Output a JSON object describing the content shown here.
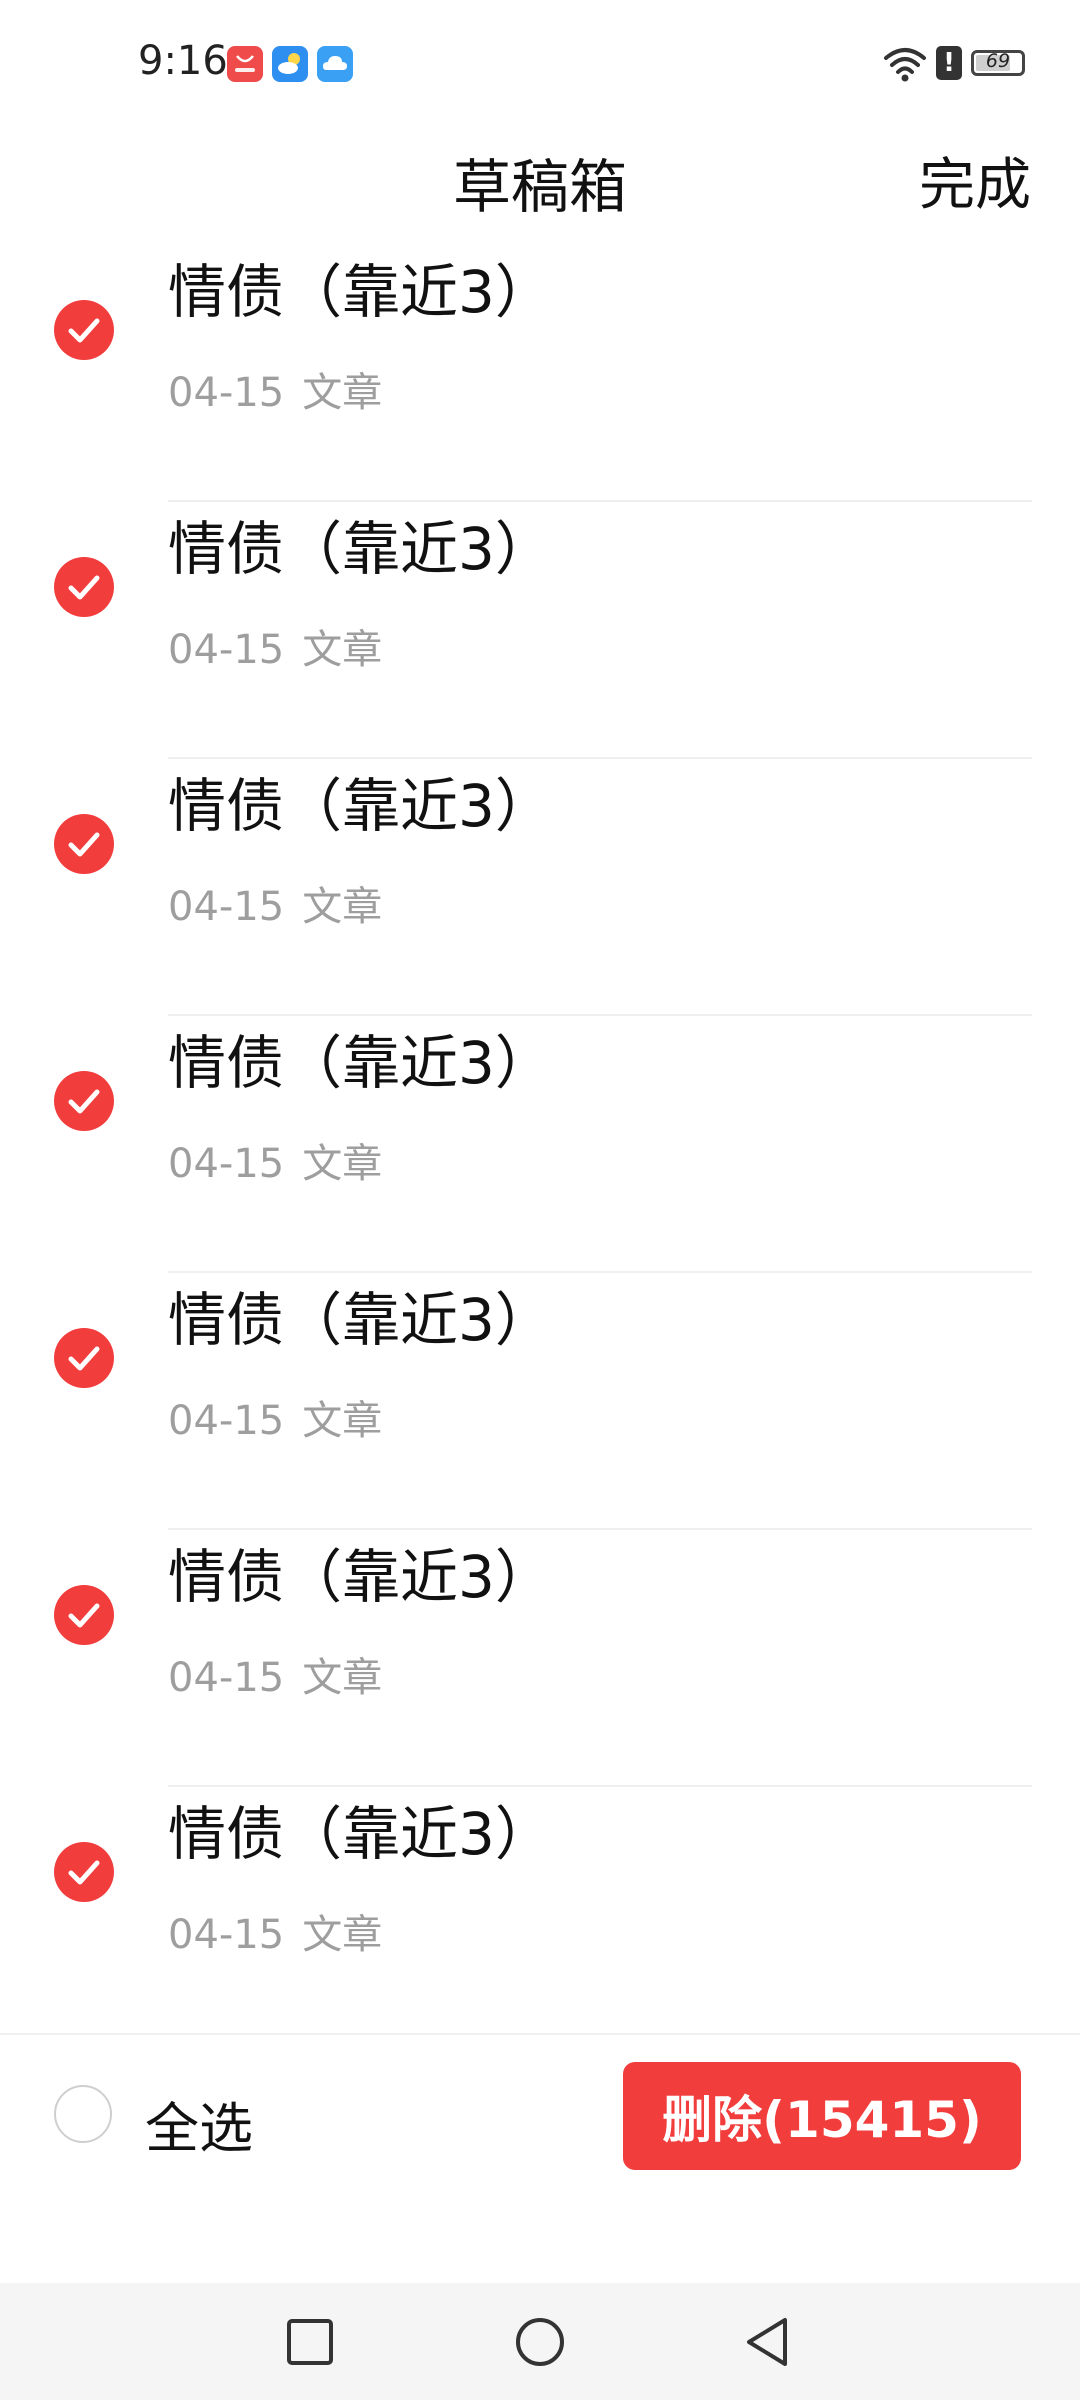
{
  "status_bar": {
    "time": "9:16",
    "battery_level": "69",
    "notification_icons": [
      "huawei-appgallery-icon",
      "weather-icon",
      "cloud-icon"
    ],
    "system_icons": [
      "wifi-icon",
      "alert-icon",
      "battery-icon"
    ]
  },
  "header": {
    "title": "草稿箱",
    "done_label": "完成"
  },
  "drafts": [
    {
      "title": "情债（靠近3）",
      "date": "04-15",
      "type": "文章",
      "selected": true
    },
    {
      "title": "情债（靠近3）",
      "date": "04-15",
      "type": "文章",
      "selected": true
    },
    {
      "title": "情债（靠近3）",
      "date": "04-15",
      "type": "文章",
      "selected": true
    },
    {
      "title": "情债（靠近3）",
      "date": "04-15",
      "type": "文章",
      "selected": true
    },
    {
      "title": "情债（靠近3）",
      "date": "04-15",
      "type": "文章",
      "selected": true
    },
    {
      "title": "情债（靠近3）",
      "date": "04-15",
      "type": "文章",
      "selected": true
    },
    {
      "title": "情债（靠近3）",
      "date": "04-15",
      "type": "文章",
      "selected": true
    }
  ],
  "bottom_bar": {
    "select_all_label": "全选",
    "select_all_checked": false,
    "delete_label": "删除(15415)"
  },
  "nav_bar": {
    "buttons": [
      "recent-apps-icon",
      "home-icon",
      "back-icon"
    ]
  },
  "colors": {
    "accent": "#f23d3d",
    "meta_text": "#9e9e9e",
    "nav_background": "#f5f5f5"
  }
}
